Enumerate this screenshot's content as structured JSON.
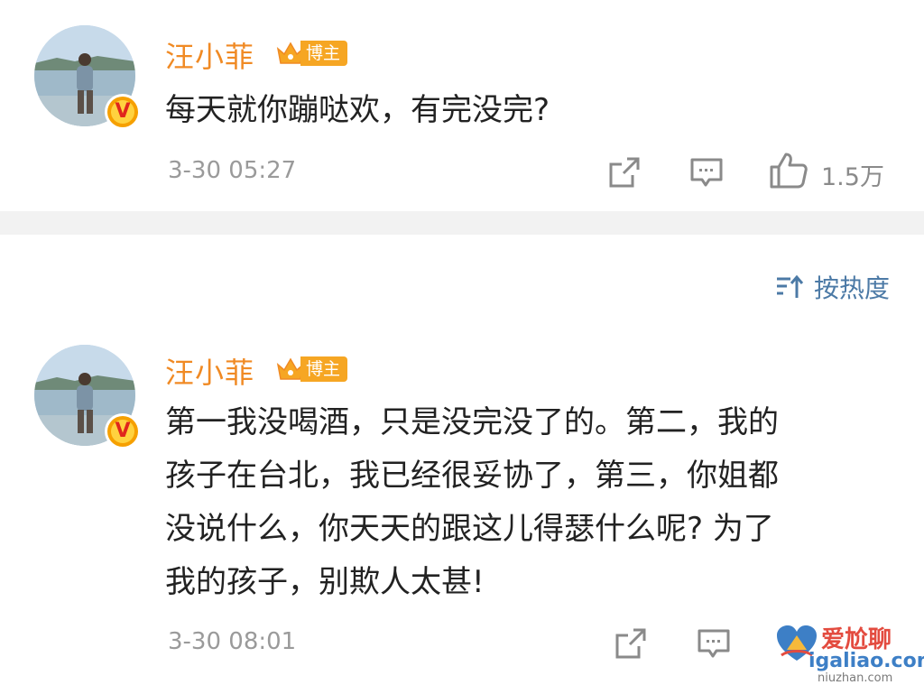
{
  "comments": [
    {
      "username": "汪小菲",
      "role_badge": "博主",
      "verified_badge": "V",
      "text": "每天就你蹦哒欢，有完没完?",
      "time": "3-30 05:27",
      "likes": "1.5万"
    },
    {
      "username": "汪小菲",
      "role_badge": "博主",
      "verified_badge": "V",
      "text_lines": [
        "第一我没喝酒，只是没完没了的。第二，我的",
        "孩子在台北，我已经很妥协了，第三，你姐都",
        "没说什么，你天天的跟这儿得瑟什么呢? 为了",
        "我的孩子，别欺人太甚!"
      ],
      "time": "3-30 08:01"
    }
  ],
  "sort": {
    "label": "按热度"
  },
  "watermark": {
    "brand": "爱尬聊",
    "domain": "igaliao.com",
    "sub": "niuzhan.com"
  },
  "colors": {
    "username": "#f08a24",
    "badge": "#f6a623",
    "link": "#4c7aa6",
    "meta": "#9a9a9a",
    "text": "#222222"
  },
  "icons": [
    "share-icon",
    "comment-icon",
    "like-icon",
    "sort-icon",
    "crown-icon",
    "verified-icon"
  ]
}
